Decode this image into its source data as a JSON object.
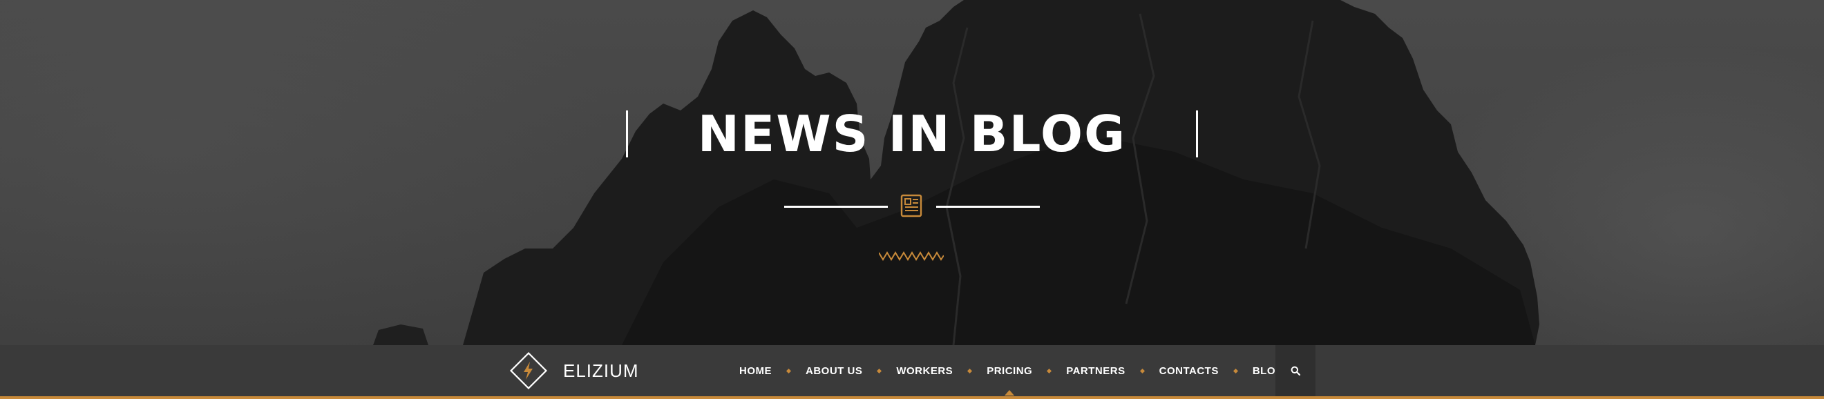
{
  "hero": {
    "title": "NEWS IN BLOG",
    "icon": "newspaper-icon",
    "ornament": "zigzag-line"
  },
  "brand": {
    "name": "ELIZIUM",
    "logo_icon": "lightning-diamond-icon"
  },
  "nav": {
    "items": [
      {
        "label": "HOME",
        "active": false
      },
      {
        "label": "ABOUT US",
        "active": false
      },
      {
        "label": "WORKERS",
        "active": false
      },
      {
        "label": "PRICING",
        "active": true
      },
      {
        "label": "PARTNERS",
        "active": false
      },
      {
        "label": "CONTACTS",
        "active": false
      },
      {
        "label": "BLOG",
        "active": false
      }
    ],
    "search_icon": "search-icon"
  },
  "colors": {
    "accent": "#c88a3a",
    "navbar": "#3a3a3a",
    "text": "#ffffff"
  }
}
